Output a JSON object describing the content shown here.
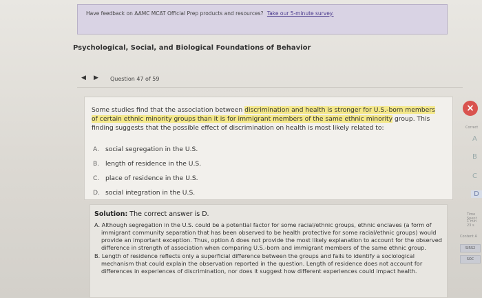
{
  "feedback": {
    "text": "Have feedback on AAMC MCAT Official Prep products and resources?",
    "link": "Take our 5-minute survey."
  },
  "section_title": "Psychological, Social, and Biological Foundations of Behavior",
  "nav": {
    "prev_icon": "triangle-left-icon",
    "next_icon": "triangle-right-icon",
    "counter": "Question 47 of 59"
  },
  "question": {
    "stem_1": "Some studies find that the association between ",
    "stem_hl": "discrimination and health is stronger for U.S.-born members of certain ethnic minority groups than it is for immigrant members of the same ethnic minority",
    "stem_2": " group. This finding suggests that the possible effect of discrimination on health is most likely related to:",
    "options": [
      {
        "letter": "A.",
        "text": "social segregation in the U.S."
      },
      {
        "letter": "B.",
        "text": "length of residence in the U.S."
      },
      {
        "letter": "C.",
        "text": "place of residence in the U.S."
      },
      {
        "letter": "D.",
        "text": "social integration in the U.S."
      }
    ]
  },
  "close_glyph": "×",
  "solution": {
    "label": "Solution:",
    "answer": " The correct answer is D.",
    "items": [
      "A. Although segregation in the U.S. could be a potential factor for some racial/ethnic groups, ethnic enclaves (a form of immigrant community separation that has been observed to be health protective for some racial/ethnic groups) would provide an important exception. Thus, option A does not provide the most likely explanation to account for the observed difference in strength of association when comparing U.S.-born and immigrant members of the same ethnic group.",
      "B. Length of residence reflects only a superficial difference between the groups and fails to identify a sociological mechanism that could explain the observation reported in the question. Length of residence does not account for differences in experiences of discrimination, nor does it suggest how different experiences could impact health."
    ]
  },
  "right_rail": {
    "correct_label": "Correct",
    "letters": [
      "A",
      "B",
      "C",
      "D"
    ],
    "time_label": "Time Spent",
    "time_value": "1 min 23 s",
    "content_label": "Content A",
    "chips": [
      "SIRS2",
      "SOC"
    ]
  }
}
